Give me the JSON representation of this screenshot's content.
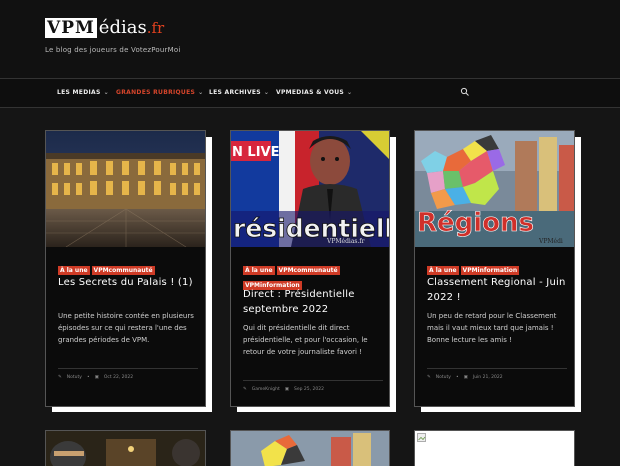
{
  "site": {
    "logo_box": "VPM",
    "logo_medias": "édias",
    "logo_fr": ".fr",
    "tagline": "Le blog des joueurs de VotezPourMoi"
  },
  "nav": {
    "items": [
      {
        "label": "LES MEDIAS",
        "chev": "⌄"
      },
      {
        "label": "GRANDES RUBRIQUES",
        "chev": "⌄"
      },
      {
        "label": "LES ARCHIVES",
        "chev": "⌄"
      },
      {
        "label": "VPMEDIAS & VOUS",
        "chev": "⌄"
      }
    ],
    "search_icon": "search-icon",
    "active_color": "#d6452b"
  },
  "cards": [
    {
      "tags": [
        "À la une",
        "VPMcommunauté"
      ],
      "title": "Les Secrets du Palais ! (1)",
      "excerpt": "Une petite histoire contée en plusieurs épisodes sur ce qui restera l'une des grandes périodes de VPM.",
      "author": "Notuty",
      "date": "Oct 22, 2022"
    },
    {
      "tags": [
        "À la une",
        "VPMcommunauté",
        "VPMinformation"
      ],
      "title": "Direct : Présidentielle septembre 2022",
      "excerpt": "Qui dit présidentielle dit direct présidentielle, et pour l'occasion, le retour de votre journaliste favori !",
      "author": "GameKnight",
      "date": "Sep 25, 2022",
      "thumb_text_live": "N LIVE",
      "thumb_text_main": "résidentiell",
      "thumb_watermark": "VPMédias.fr"
    },
    {
      "tags": [
        "À la une",
        "VPMinformation"
      ],
      "title": "Classement Regional - Juin 2022 !",
      "excerpt": "Un peu de retard pour le Classement mais il vaut mieux tard que jamais ! Bonne lecture les amis !",
      "author": "Notuty",
      "date": "Juin 21, 2022",
      "thumb_text_main": "Régions",
      "thumb_watermark": "VPMédi"
    }
  ],
  "colors": {
    "tag_bg": "#cf3b26",
    "page_bg": "#151515"
  }
}
